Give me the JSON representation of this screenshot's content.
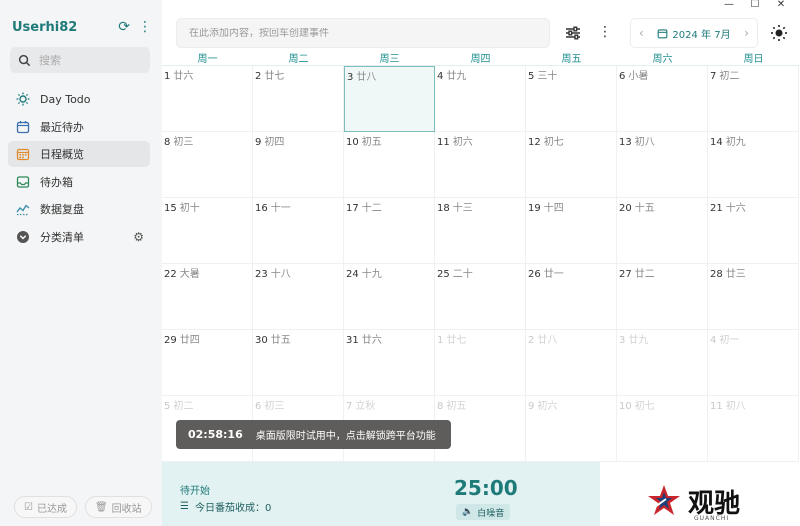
{
  "window": {
    "minimize": "—",
    "maximize": "☐",
    "close": "✕"
  },
  "sidebar": {
    "username": "Userhi82",
    "search_placeholder": "搜索",
    "items": [
      {
        "label": "Day Todo",
        "icon": "sun-icon"
      },
      {
        "label": "最近待办",
        "icon": "calendar-icon"
      },
      {
        "label": "日程概览",
        "icon": "calendar-grid-icon",
        "active": true
      },
      {
        "label": "待办箱",
        "icon": "inbox-icon"
      },
      {
        "label": "数据复盘",
        "icon": "chart-icon"
      },
      {
        "label": "分类清单",
        "icon": "category-icon"
      }
    ],
    "done_label": "已达成",
    "trash_label": "回收站"
  },
  "toolbar": {
    "add_placeholder": "在此添加内容，按回车创建事件",
    "month_label": "2024 年 7月"
  },
  "calendar": {
    "weekdays": [
      "周一",
      "周二",
      "周三",
      "周四",
      "周五",
      "周六",
      "周日"
    ],
    "weeks": [
      [
        [
          "1",
          "廿六"
        ],
        [
          "2",
          "廿七"
        ],
        [
          "3",
          "廿八"
        ],
        [
          "4",
          "廿九"
        ],
        [
          "5",
          "三十"
        ],
        [
          "6",
          "小暑"
        ],
        [
          "7",
          "初二"
        ]
      ],
      [
        [
          "8",
          "初三"
        ],
        [
          "9",
          "初四"
        ],
        [
          "10",
          "初五"
        ],
        [
          "11",
          "初六"
        ],
        [
          "12",
          "初七"
        ],
        [
          "13",
          "初八"
        ],
        [
          "14",
          "初九"
        ]
      ],
      [
        [
          "15",
          "初十"
        ],
        [
          "16",
          "十一"
        ],
        [
          "17",
          "十二"
        ],
        [
          "18",
          "十三"
        ],
        [
          "19",
          "十四"
        ],
        [
          "20",
          "十五"
        ],
        [
          "21",
          "十六"
        ]
      ],
      [
        [
          "22",
          "大暑"
        ],
        [
          "23",
          "十八"
        ],
        [
          "24",
          "十九"
        ],
        [
          "25",
          "二十"
        ],
        [
          "26",
          "廿一"
        ],
        [
          "27",
          "廿二"
        ],
        [
          "28",
          "廿三"
        ]
      ],
      [
        [
          "29",
          "廿四"
        ],
        [
          "30",
          "廿五"
        ],
        [
          "31",
          "廿六"
        ],
        [
          "1",
          "廿七"
        ],
        [
          "2",
          "廿八"
        ],
        [
          "3",
          "廿九"
        ],
        [
          "4",
          "初一"
        ]
      ],
      [
        [
          "5",
          "初二"
        ],
        [
          "6",
          "初三"
        ],
        [
          "7",
          "立秋"
        ],
        [
          "8",
          "初五"
        ],
        [
          "9",
          "初六"
        ],
        [
          "10",
          "初七"
        ],
        [
          "11",
          "初八"
        ]
      ]
    ],
    "today_index": [
      0,
      2
    ],
    "other_month_from": [
      4,
      3
    ]
  },
  "toast": {
    "time": "02:58:16",
    "message": "桌面版限时试用中，点击解锁跨平台功能"
  },
  "bottom": {
    "pending_label": "待开始",
    "today_count": "今日番茄收成：0",
    "timer": "25:00",
    "noise_label": "白噪音"
  },
  "logo": {
    "text": "观驰",
    "sub": "GUANCHI"
  },
  "colors": {
    "accent": "#1f7a7a",
    "weekday": "#1f8f8f",
    "bottom_bar": "#e2f1f1"
  }
}
